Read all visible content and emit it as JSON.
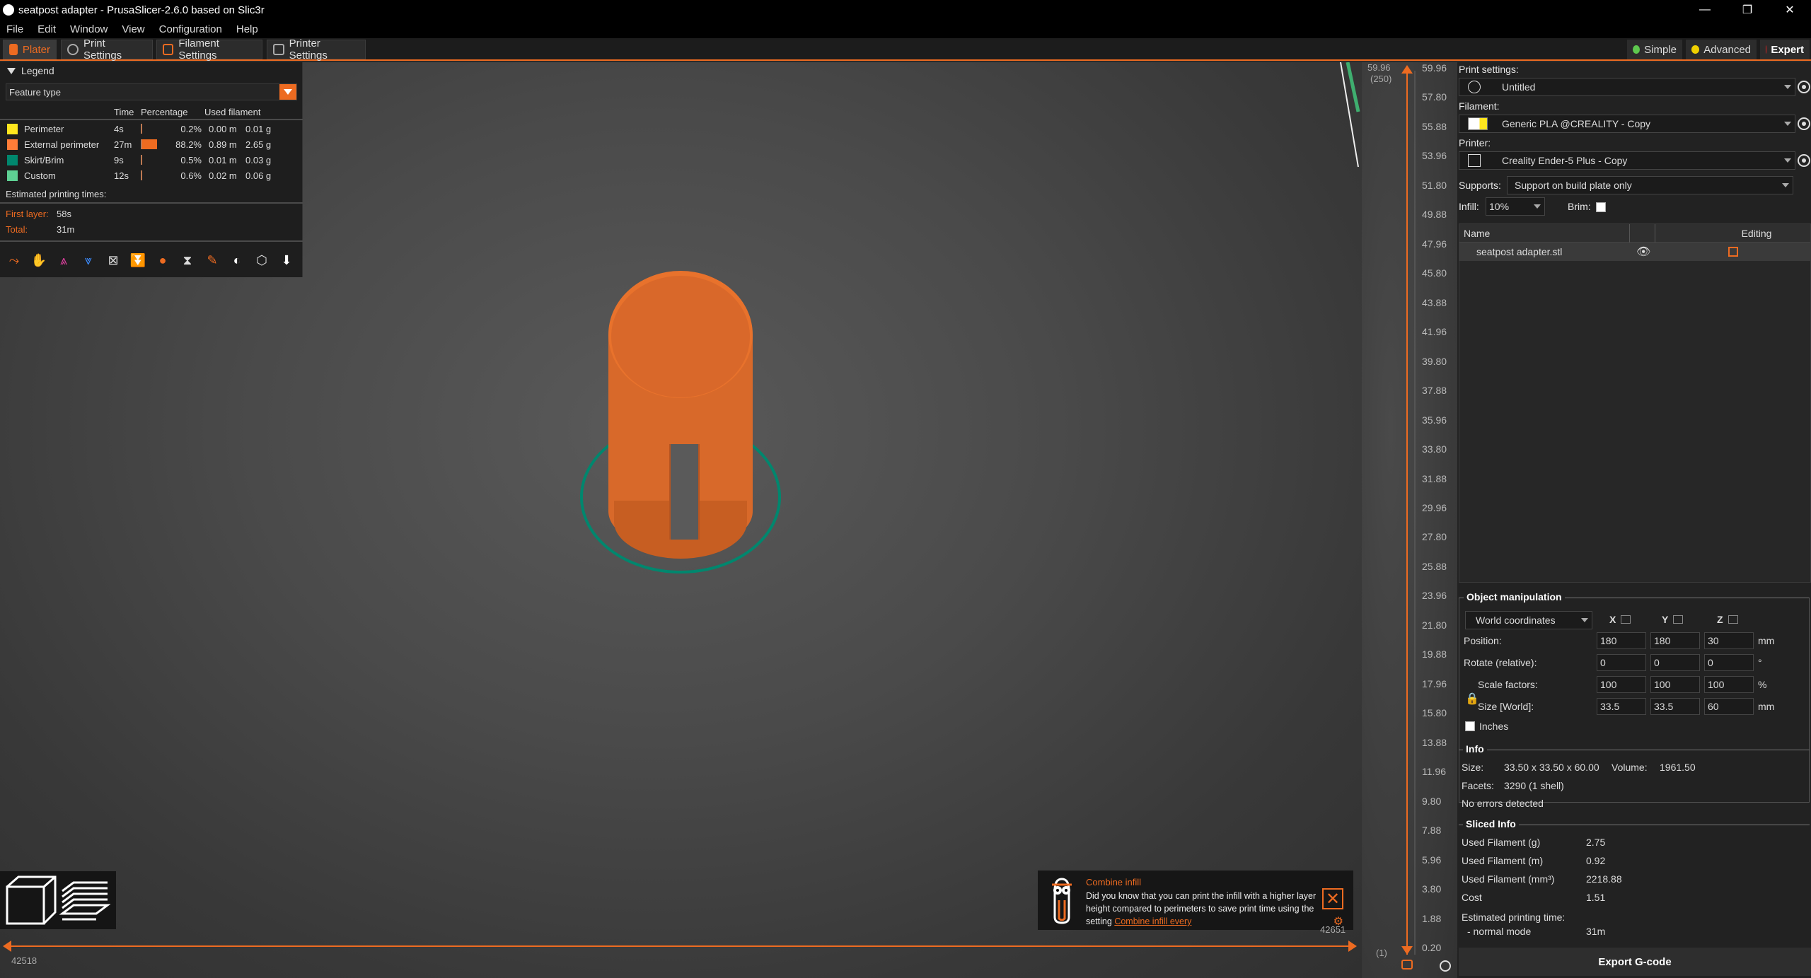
{
  "window": {
    "title": "seatpost adapter - PrusaSlicer-2.6.0 based on Slic3r",
    "controls": [
      "—",
      "❐",
      "✕"
    ]
  },
  "menu": [
    "File",
    "Edit",
    "Window",
    "View",
    "Configuration",
    "Help"
  ],
  "tabs": [
    {
      "label": "Plater",
      "icon": "plater-icon"
    },
    {
      "label": "Print Settings",
      "icon": "print-settings-icon"
    },
    {
      "label": "Filament Settings",
      "icon": "filament-icon"
    },
    {
      "label": "Printer Settings",
      "icon": "printer-icon"
    }
  ],
  "modes": [
    {
      "label": "Simple",
      "color": "#5ec84e"
    },
    {
      "label": "Advanced",
      "color": "#f0d000"
    },
    {
      "label": "Expert",
      "color": "#e02020"
    }
  ],
  "legend": {
    "title": "Legend",
    "view_type": "Feature type",
    "headers": {
      "time": "Time",
      "percentage": "Percentage",
      "used_filament": "Used filament"
    },
    "rows": [
      {
        "name": "Perimeter",
        "color": "#ffe61e",
        "time": "4s",
        "fraction": 0.002,
        "pct": "0.2%",
        "length": "0.00 m",
        "weight": "0.01 g"
      },
      {
        "name": "External perimeter",
        "color": "#ff7d38",
        "time": "27m",
        "fraction": 0.882,
        "pct": "88.2%",
        "length": "0.89 m",
        "weight": "2.65 g"
      },
      {
        "name": "Skirt/Brim",
        "color": "#00876e",
        "time": "9s",
        "fraction": 0.005,
        "pct": "0.5%",
        "length": "0.01 m",
        "weight": "0.03 g"
      },
      {
        "name": "Custom",
        "color": "#5ed194",
        "time": "12s",
        "fraction": 0.006,
        "pct": "0.6%",
        "length": "0.02 m",
        "weight": "0.06 g"
      }
    ],
    "est_title": "Estimated printing times:",
    "first_layer_label": "First layer:",
    "first_layer": "58s",
    "total_label": "Total:",
    "total": "31m"
  },
  "tip": {
    "title": "Combine infill",
    "body": "Did you know that you can print the infill with a higher layer height compared to perimeters to save print time using the setting ",
    "link": "Combine infill every"
  },
  "hslider": {
    "left": "42518",
    "right": "42651"
  },
  "vslider": {
    "top_value": "59.96",
    "top_layer": "(250)",
    "bottom_value": "0.20",
    "bottom_layer": "(1)",
    "ticks": [
      "59.96",
      "57.80",
      "55.88",
      "53.96",
      "51.80",
      "49.88",
      "47.96",
      "45.80",
      "43.88",
      "41.96",
      "39.80",
      "37.88",
      "35.96",
      "33.80",
      "31.88",
      "29.96",
      "27.80",
      "25.88",
      "23.96",
      "21.80",
      "19.88",
      "17.96",
      "15.80",
      "13.88",
      "11.96",
      "9.80",
      "7.88",
      "5.96",
      "3.80",
      "1.88",
      "0.20"
    ]
  },
  "sidebar": {
    "print_settings_label": "Print settings:",
    "print_settings": "Untitled",
    "filament_label": "Filament:",
    "filament": "Generic PLA @CREALITY - Copy",
    "printer_label": "Printer:",
    "printer": "Creality Ender-5 Plus - Copy",
    "supports_label": "Supports:",
    "supports": "Support on build plate only",
    "infill_label": "Infill:",
    "infill": "10%",
    "brim_label": "Brim:",
    "objlist": {
      "col_name": "Name",
      "col_editing": "Editing",
      "object": "seatpost adapter.stl"
    },
    "manip": {
      "title": "Object manipulation",
      "coords": "World coordinates",
      "axes": [
        "X",
        "Y",
        "Z"
      ],
      "rows": [
        {
          "label": "Position:",
          "values": [
            "180",
            "180",
            "30"
          ],
          "unit": "mm"
        },
        {
          "label": "Rotate (relative):",
          "values": [
            "0",
            "0",
            "0"
          ],
          "unit": "°"
        },
        {
          "label": "Scale factors:",
          "values": [
            "100",
            "100",
            "100"
          ],
          "unit": "%"
        },
        {
          "label": "Size [World]:",
          "values": [
            "33.5",
            "33.5",
            "60"
          ],
          "unit": "mm"
        }
      ],
      "inches": "Inches"
    },
    "info": {
      "title": "Info",
      "size_label": "Size:",
      "size": "33.50 x 33.50 x 60.00",
      "volume_label": "Volume:",
      "volume": "1961.50",
      "facets_label": "Facets:",
      "facets": "3290 (1 shell)",
      "errors": "No errors detected"
    },
    "sliced": {
      "title": "Sliced Info",
      "rows": [
        {
          "label": "Used Filament (g)",
          "value": "2.75"
        },
        {
          "label": "Used Filament (m)",
          "value": "0.92"
        },
        {
          "label": "Used Filament (mm³)",
          "value": "2218.88"
        },
        {
          "label": "Cost",
          "value": "1.51"
        }
      ],
      "est_label": "Estimated printing time:",
      "mode_label": "- normal mode",
      "mode_value": "31m"
    },
    "export": "Export G-code"
  },
  "colors": {
    "accent": "#ed6b21",
    "model": "#e8722c",
    "brim": "#00876e"
  }
}
